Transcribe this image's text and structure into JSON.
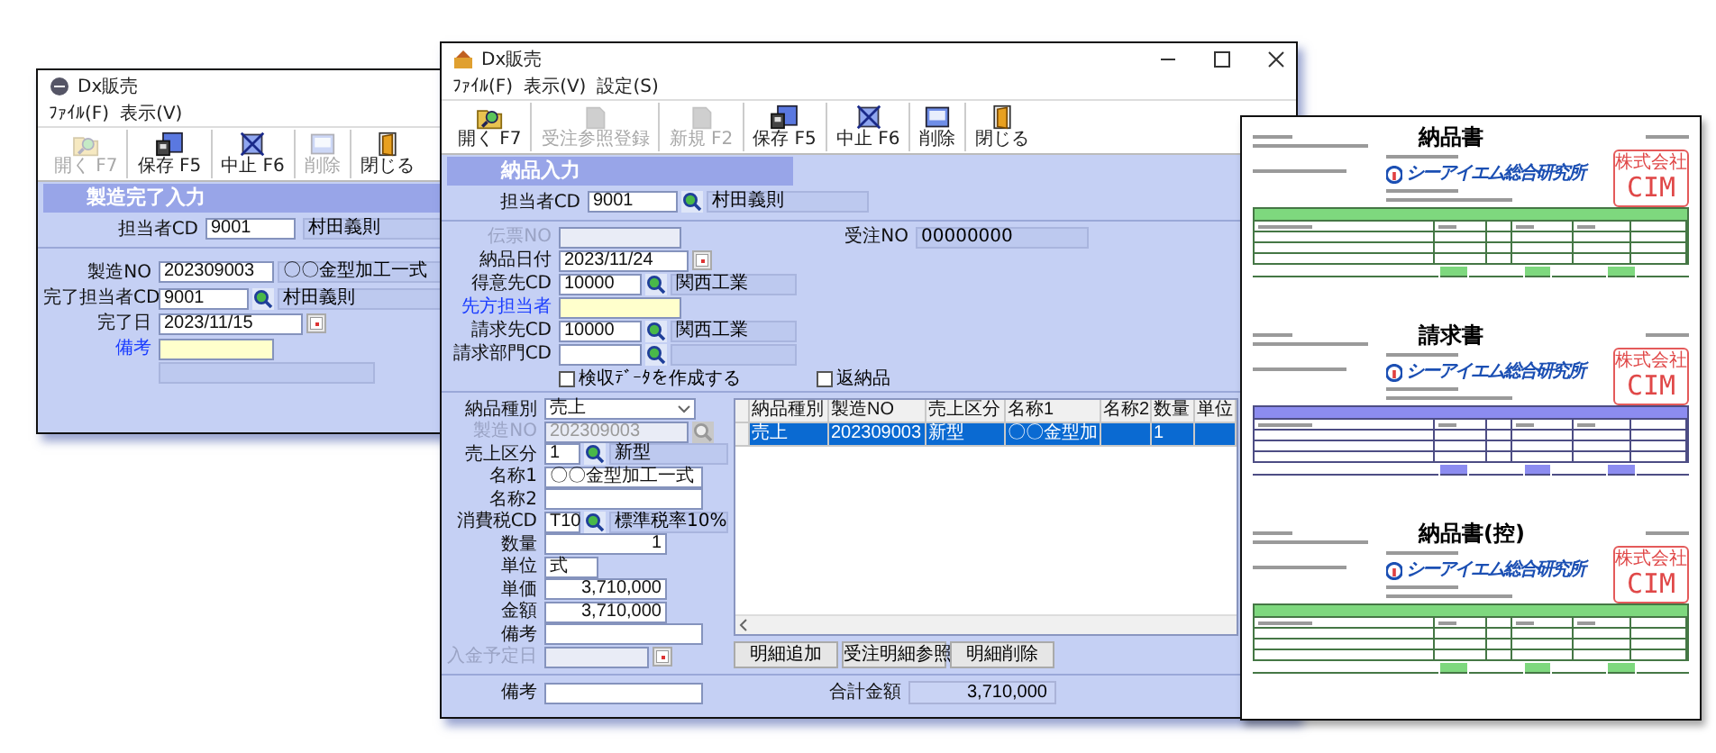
{
  "back_window": {
    "title": "Dx販売",
    "menu": [
      "ﾌｧｲﾙ(F)",
      "表示(V)"
    ],
    "toolbar": [
      {
        "kind": "open",
        "label": "開く F7",
        "disabled": true
      },
      {
        "kind": "save",
        "label": "保存 F5",
        "disabled": false
      },
      {
        "kind": "cancel",
        "label": "中止 F6",
        "disabled": false
      },
      {
        "kind": "delete",
        "label": "削除",
        "disabled": true
      },
      {
        "kind": "close",
        "label": "閉じる",
        "disabled": false
      }
    ],
    "heading": "製造完了入力",
    "staff": {
      "label": "担当者CD",
      "value": "9001",
      "name": "村田義則"
    },
    "fields": [
      {
        "kind": "text_name",
        "label": "製造NO",
        "value": "202309003",
        "name": "〇〇金型加工一式",
        "focused": false
      },
      {
        "kind": "lookup",
        "label": "完了担当者CD",
        "value": "9001",
        "name": "村田義則",
        "focused": false
      },
      {
        "kind": "date",
        "label": "完了日",
        "value": "2023/11/15",
        "focused": false
      },
      {
        "kind": "text",
        "label": "備考",
        "focused": true
      }
    ]
  },
  "front_window": {
    "title": "Dx販売",
    "menu": [
      "ﾌｧｲﾙ(F)",
      "表示(V)",
      "設定(S)"
    ],
    "toolbar": [
      {
        "kind": "open",
        "label": "開く F7",
        "disabled": false
      },
      {
        "kind": "page",
        "label": "受注参照登録",
        "disabled": true
      },
      {
        "kind": "page",
        "label": "新規 F2",
        "disabled": true
      },
      {
        "kind": "save",
        "label": "保存 F5",
        "disabled": false
      },
      {
        "kind": "cancel",
        "label": "中止 F6",
        "disabled": false
      },
      {
        "kind": "delete",
        "label": "削除",
        "disabled": false
      },
      {
        "kind": "close",
        "label": "閉じる",
        "disabled": false
      }
    ],
    "heading": "納品入力",
    "staff": {
      "label": "担当者CD",
      "value": "9001",
      "name": "村田義則"
    },
    "order_no": {
      "label": "受注NO",
      "value": "00000000"
    },
    "form": [
      {
        "kind": "text",
        "label": "伝票NO",
        "disabled": true,
        "focused": false
      },
      {
        "kind": "date",
        "label": "納品日付",
        "value": "2023/11/24",
        "disabled": false,
        "focused": false
      },
      {
        "kind": "lookup",
        "label": "得意先CD",
        "value": "10000",
        "name": "関西工業",
        "disabled": false,
        "focused": false
      },
      {
        "kind": "text",
        "label": "先方担当者",
        "disabled": false,
        "focused": true
      },
      {
        "kind": "lookup",
        "label": "請求先CD",
        "value": "10000",
        "name": "関西工業",
        "disabled": false,
        "focused": false
      },
      {
        "kind": "lookup",
        "label": "請求部門CD",
        "disabled": false,
        "focused": false
      }
    ],
    "checkboxes": [
      {
        "label": "検収ﾃﾞｰﾀを作成する",
        "checked": false
      },
      {
        "label": "返納品",
        "checked": false
      }
    ],
    "detail": [
      {
        "kind": "select",
        "label": "納品種別",
        "value": "売上",
        "disabled": false
      },
      {
        "kind": "search_text",
        "label": "製造NO",
        "value": "202309003",
        "disabled": true
      },
      {
        "kind": "lookup",
        "label": "売上区分",
        "value": "1",
        "name": "新型",
        "disabled": false
      },
      {
        "kind": "text",
        "label": "名称1",
        "value": "〇〇金型加工一式",
        "disabled": false
      },
      {
        "kind": "text",
        "label": "名称2",
        "disabled": false
      },
      {
        "kind": "lookup",
        "label": "消費税CD",
        "value": "T10",
        "name": "標準税率10%",
        "disabled": false
      },
      {
        "kind": "number",
        "label": "数量",
        "value": "1",
        "disabled": false
      },
      {
        "kind": "short",
        "label": "単位",
        "value": "式",
        "disabled": false
      },
      {
        "kind": "number",
        "label": "単価",
        "value": "3,710,000",
        "disabled": false
      },
      {
        "kind": "number",
        "label": "金額",
        "value": "3,710,000",
        "disabled": false
      },
      {
        "kind": "text",
        "label": "備考",
        "disabled": false
      },
      {
        "kind": "date",
        "label": "入金予定日",
        "disabled": true
      }
    ],
    "grid": {
      "columns": [
        "納品種別",
        "製造NO",
        "売上区分",
        "名称1",
        "名称2",
        "数量",
        "単位"
      ],
      "rows": [
        {
          "cells": [
            "売上",
            "202309003",
            "新型",
            "〇〇金型加",
            null,
            "1",
            null
          ],
          "selected": true
        }
      ]
    },
    "grid_buttons": [
      "明細追加",
      "受注明細参照",
      "明細削除"
    ],
    "footer": {
      "note_label": "備考",
      "total_label": "合計金額",
      "total": "3,710,000"
    }
  },
  "document": {
    "sections": [
      {
        "title": "納品書",
        "color": "#7ed87e",
        "logo": "シーアイエム総合研究所",
        "stamp": [
          "株式会社",
          "CIM"
        ]
      },
      {
        "title": "請求書",
        "color": "#8c8cf0",
        "logo": "シーアイエム総合研究所",
        "stamp": [
          "株式会社",
          "CIM"
        ]
      },
      {
        "title": "納品書(控)",
        "color": "#7ed87e",
        "logo": "シーアイエム総合研究所",
        "stamp": [
          "株式会社",
          "CIM"
        ]
      }
    ]
  }
}
